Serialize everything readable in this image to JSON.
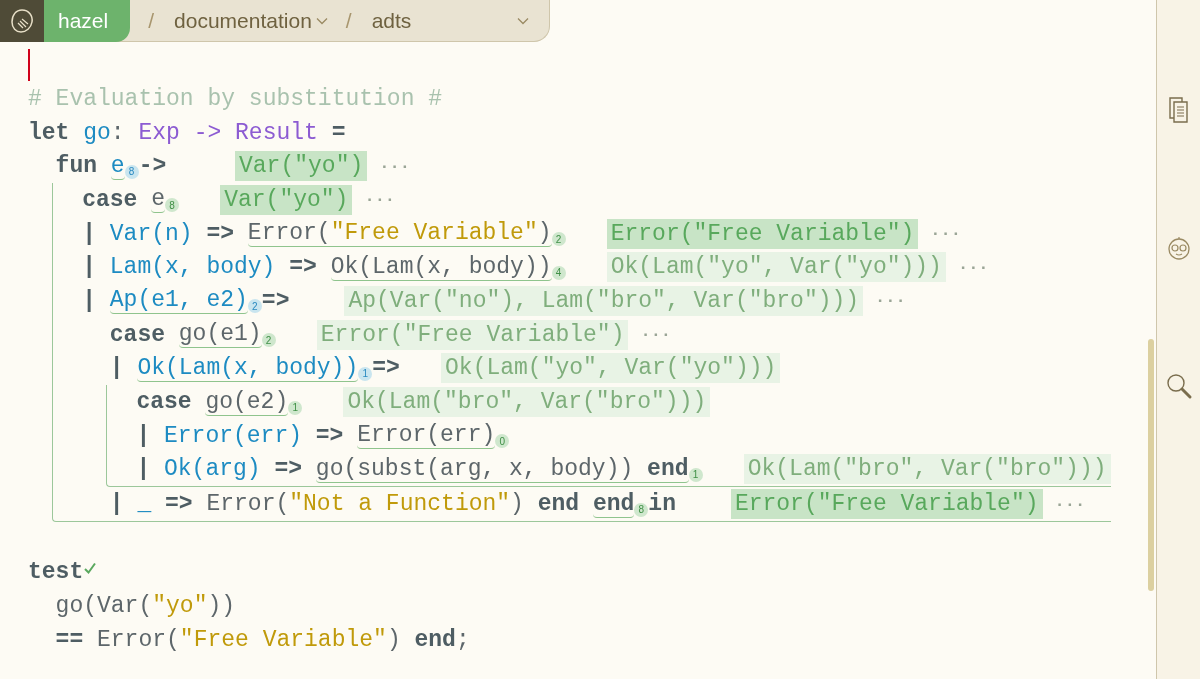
{
  "header": {
    "app": "hazel",
    "crumbs": [
      {
        "separator": "/",
        "text": "documentation",
        "dropdown": true
      },
      {
        "separator": "/",
        "text": "adts",
        "dropdown": true
      }
    ]
  },
  "code": [
    {
      "segments": [
        {
          "text": "# Evaluation by substitution #",
          "kind": "comment"
        }
      ]
    },
    {
      "segments": [
        {
          "text": "let ",
          "kind": "kw"
        },
        {
          "text": "go",
          "kind": "pat"
        },
        {
          "text": ": ",
          "kind": "plain"
        },
        {
          "text": "Exp -> Result ",
          "kind": "type"
        },
        {
          "text": "=",
          "kind": "op"
        }
      ],
      "children": [
        {
          "segments": [
            {
              "text": "fun ",
              "kind": "kw"
            },
            {
              "kind": "probe",
              "pattern": true,
              "count": "8",
              "tokens": [
                {
                  "text": "e",
                  "kind": "pat"
                }
              ]
            },
            {
              "text": "->",
              "kind": "op"
            }
          ],
          "result": {
            "text": "Var(\"yo\")",
            "faint": false,
            "more": "···"
          },
          "boxed": true,
          "children": [
            {
              "segments": [
                {
                  "text": "case ",
                  "kind": "kw"
                },
                {
                  "kind": "probe",
                  "pattern": false,
                  "count": "8",
                  "tokens": [
                    {
                      "text": "e",
                      "kind": "plain"
                    }
                  ]
                }
              ],
              "result": {
                "text": "Var(\"yo\")",
                "faint": false,
                "more": "···"
              }
            },
            {
              "segments": [
                {
                  "text": "| ",
                  "kind": "op"
                },
                {
                  "text": "Var(n)",
                  "kind": "pat"
                },
                {
                  "text": " => ",
                  "kind": "op"
                },
                {
                  "kind": "probe",
                  "pattern": false,
                  "count": "2",
                  "tokens": [
                    {
                      "text": "Error(",
                      "kind": "plain"
                    },
                    {
                      "text": "\"Free Variable\"",
                      "kind": "str"
                    },
                    {
                      "text": ")",
                      "kind": "plain"
                    }
                  ]
                }
              ],
              "result": {
                "text": "Error(\"Free Variable\")",
                "faint": false,
                "more": "···"
              }
            },
            {
              "segments": [
                {
                  "text": "| ",
                  "kind": "op"
                },
                {
                  "text": "Lam(x, body)",
                  "kind": "pat"
                },
                {
                  "text": " => ",
                  "kind": "op"
                },
                {
                  "kind": "probe",
                  "pattern": false,
                  "count": "4",
                  "tokens": [
                    {
                      "text": "Ok(Lam(x, body))",
                      "kind": "plain"
                    }
                  ]
                }
              ],
              "result": {
                "text": "Ok(Lam(\"yo\", Var(\"yo\")))",
                "faint": true,
                "more": "···"
              }
            },
            {
              "segments": [
                {
                  "text": "| ",
                  "kind": "op"
                },
                {
                  "kind": "probe",
                  "pattern": true,
                  "count": "2",
                  "tokens": [
                    {
                      "text": "Ap(e1, e2)",
                      "kind": "pat"
                    }
                  ]
                },
                {
                  "text": "=>",
                  "kind": "op"
                }
              ],
              "result": {
                "text": "Ap(Var(\"no\"), Lam(\"bro\", Var(\"bro\")))",
                "faint": true,
                "more": "···"
              },
              "children": [
                {
                  "segments": [
                    {
                      "text": "case ",
                      "kind": "kw"
                    },
                    {
                      "kind": "probe",
                      "pattern": false,
                      "count": "2",
                      "tokens": [
                        {
                          "text": "go(e1)",
                          "kind": "plain"
                        }
                      ]
                    }
                  ],
                  "result": {
                    "text": "Error(\"Free Variable\")",
                    "faint": true,
                    "more": "···"
                  }
                },
                {
                  "segments": [
                    {
                      "text": "| ",
                      "kind": "op"
                    },
                    {
                      "kind": "probe",
                      "pattern": true,
                      "count": "1",
                      "tokens": [
                        {
                          "text": "Ok(Lam(x, body))",
                          "kind": "pat"
                        }
                      ]
                    },
                    {
                      "text": "=>",
                      "kind": "op"
                    }
                  ],
                  "result": {
                    "text": "Ok(Lam(\"yo\", Var(\"yo\")))",
                    "faint": true
                  },
                  "boxed": true,
                  "children": [
                    {
                      "segments": [
                        {
                          "text": "case ",
                          "kind": "kw"
                        },
                        {
                          "kind": "probe",
                          "pattern": false,
                          "count": "1",
                          "tokens": [
                            {
                              "text": "go(e2)",
                              "kind": "plain"
                            }
                          ]
                        }
                      ],
                      "result": {
                        "text": "Ok(Lam(\"bro\", Var(\"bro\")))",
                        "faint": true
                      }
                    },
                    {
                      "segments": [
                        {
                          "text": "| ",
                          "kind": "op"
                        },
                        {
                          "text": "Error(err)",
                          "kind": "pat"
                        },
                        {
                          "text": " => ",
                          "kind": "op"
                        },
                        {
                          "kind": "probe",
                          "pattern": false,
                          "count": "0",
                          "tokens": [
                            {
                              "text": "Error(err)",
                              "kind": "plain"
                            }
                          ]
                        }
                      ]
                    },
                    {
                      "segments": [
                        {
                          "text": "| ",
                          "kind": "op"
                        },
                        {
                          "text": "Ok(arg)",
                          "kind": "pat"
                        },
                        {
                          "text": " => ",
                          "kind": "op"
                        },
                        {
                          "kind": "probe",
                          "pattern": false,
                          "count": "1",
                          "tokens": [
                            {
                              "text": "go(subst(arg, x, body)) ",
                              "kind": "plain"
                            },
                            {
                              "text": "end",
                              "kind": "kw"
                            }
                          ]
                        }
                      ],
                      "result": {
                        "text": "Ok(Lam(\"bro\", Var(\"bro\")))",
                        "faint": true
                      }
                    }
                  ]
                },
                {
                  "segments": [
                    {
                      "text": "| ",
                      "kind": "op"
                    },
                    {
                      "text": "_",
                      "kind": "pat"
                    },
                    {
                      "text": " => ",
                      "kind": "op"
                    },
                    {
                      "text": "Error(",
                      "kind": "plain"
                    },
                    {
                      "text": "\"Not a Function\"",
                      "kind": "str"
                    },
                    {
                      "text": ") ",
                      "kind": "plain"
                    },
                    {
                      "text": "end ",
                      "kind": "kw"
                    },
                    {
                      "kind": "probe",
                      "pattern": false,
                      "count": "8",
                      "tokens": [
                        {
                          "text": "end",
                          "kind": "kw"
                        }
                      ]
                    },
                    {
                      "text": "in",
                      "kind": "kw"
                    }
                  ],
                  "result": {
                    "text": "Error(\"Free Variable\")",
                    "faint": false,
                    "more": "···"
                  }
                }
              ]
            }
          ]
        }
      ]
    },
    {
      "segments": [
        {
          "text": "test",
          "kind": "kw"
        }
      ],
      "passed": true,
      "gap": true,
      "children": [
        {
          "segments": [
            {
              "text": "go(Var(",
              "kind": "plain"
            },
            {
              "text": "\"yo\"",
              "kind": "str"
            },
            {
              "text": "))",
              "kind": "plain"
            }
          ]
        },
        {
          "segments": [
            {
              "text": "== ",
              "kind": "op"
            },
            {
              "text": "Error(",
              "kind": "plain"
            },
            {
              "text": "\"Free Variable\"",
              "kind": "str"
            },
            {
              "text": ") ",
              "kind": "plain"
            },
            {
              "text": "end",
              "kind": "kw"
            },
            {
              "text": ";",
              "kind": "plain"
            }
          ]
        }
      ]
    }
  ]
}
